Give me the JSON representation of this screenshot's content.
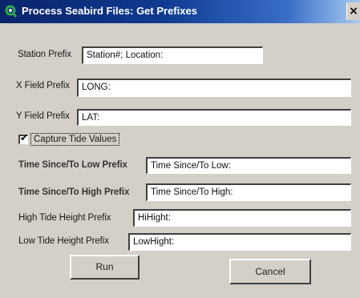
{
  "window": {
    "title": "Process Seabird Files: Get Prefixes",
    "close_glyph": "×",
    "colors": {
      "titlebar_start": "#0a246a",
      "titlebar_end": "#a6caf0",
      "face": "#d4d0c8"
    }
  },
  "fields": {
    "station": {
      "label": "Station Prefix",
      "value": "Station#; Location:"
    },
    "x": {
      "label": "X Field Prefix",
      "value": "LONG:"
    },
    "y": {
      "label": "Y Field Prefix",
      "value": "LAT:"
    },
    "time_low": {
      "label": "Time Since/To Low Prefix",
      "value": "Time Since/To Low:"
    },
    "time_high": {
      "label": "Time Since/To High Prefix",
      "value": "Time Since/To High:"
    },
    "high_tide": {
      "label": "High Tide Height Prefix",
      "value": "HiHight:"
    },
    "low_tide": {
      "label": "Low Tide Height Prefix",
      "value": "LowHight:"
    }
  },
  "capture_tide": {
    "label": "Capture Tide Values",
    "checked": true,
    "mark": "✔"
  },
  "buttons": {
    "run": "Run",
    "cancel": "Cancel"
  }
}
